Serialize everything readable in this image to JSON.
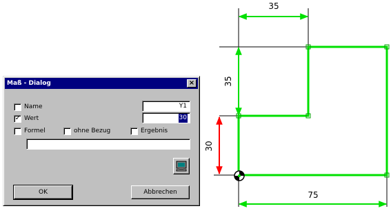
{
  "dialog": {
    "title": "Maß - Dialog",
    "close_glyph": "×",
    "fields": {
      "name": {
        "label": "Name",
        "checked": false,
        "value": "Y1"
      },
      "wert": {
        "label": "Wert",
        "checked": true,
        "value": "30"
      }
    },
    "options": {
      "formel": {
        "label": "Formel",
        "checked": false
      },
      "ohne_bezug": {
        "label": "ohne Bezug",
        "checked": false
      },
      "ergebnis": {
        "label": "Ergebnis",
        "checked": false
      }
    },
    "formula_value": "",
    "icon": "computer-monitor-icon",
    "ok_label": "OK",
    "cancel_label": "Abbrechen"
  },
  "drawing": {
    "dimensions": {
      "top_width": "35",
      "left_height": "35",
      "selected_height": "30",
      "bottom_width": "75"
    },
    "colors": {
      "geometry": "#00e000",
      "dimension": "#00e000",
      "selected_dimension": "#ff0000",
      "extension_line": "#000000"
    }
  }
}
